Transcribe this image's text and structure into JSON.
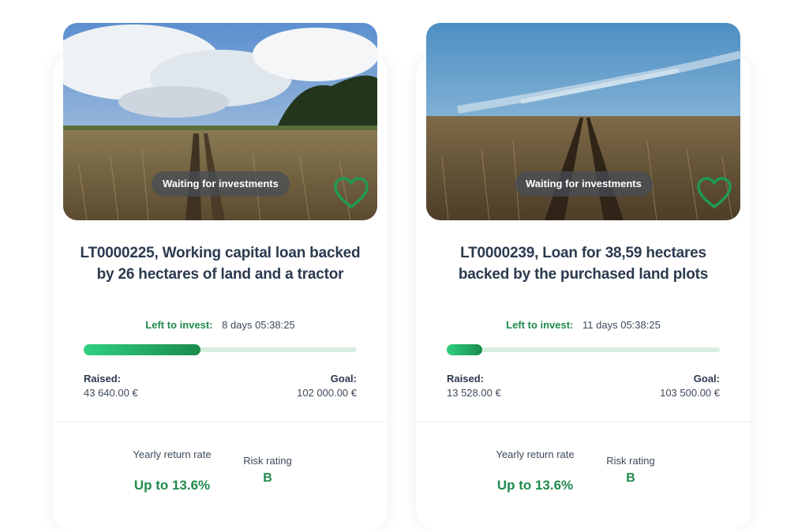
{
  "projects": [
    {
      "status": "Waiting for investments",
      "title": "LT0000225, Working capital loan backed by 26 hectares of land and a tractor",
      "left_label": "Left to invest:",
      "left_value": "8 days 05:38:25",
      "progress": 0.428,
      "raised_label": "Raised:",
      "raised_value": "43 640.00 €",
      "goal_label": "Goal:",
      "goal_value": "102 000.00 €",
      "yearly_label": "Yearly return rate",
      "yearly_value": "Up to 13.6%",
      "risk_label": "Risk rating",
      "risk_value": "B",
      "image": "field-cloudy-sky"
    },
    {
      "status": "Waiting for investments",
      "title": "LT0000239, Loan for 38,59 hectares backed by the purchased land plots",
      "left_label": "Left to invest:",
      "left_value": "11 days 05:38:25",
      "progress": 0.131,
      "raised_label": "Raised:",
      "raised_value": "13 528.00 €",
      "goal_label": "Goal:",
      "goal_value": "103 500.00 €",
      "yearly_label": "Yearly return rate",
      "yearly_value": "Up to 13.6%",
      "risk_label": "Risk rating",
      "risk_value": "B",
      "image": "field-clear-sky"
    }
  ],
  "icons": {
    "favorite": "heart-outline-icon"
  },
  "colors": {
    "accent": "#1f8a4c",
    "progress_start": "#2fd07e",
    "progress_end": "#1a8b49",
    "progress_track": "#d7eee0"
  }
}
